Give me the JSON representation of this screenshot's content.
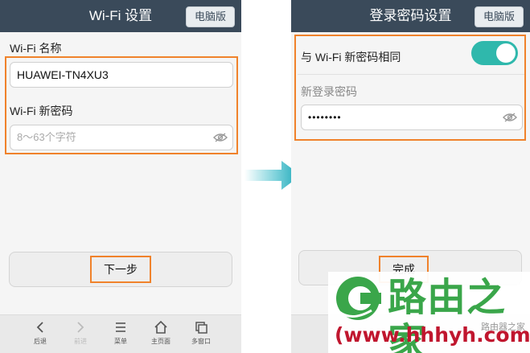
{
  "left": {
    "title": "Wi-Fi 设置",
    "pc_button": "电脑版",
    "ssid_label": "Wi-Fi 名称",
    "ssid_value": "HUAWEI-TN4XU3",
    "password_label": "Wi-Fi 新密码",
    "password_placeholder": "8～63个字符",
    "next_button": "下一步",
    "nav": {
      "back": "后退",
      "forward": "前进",
      "menu": "菜单",
      "home": "主页面",
      "windows": "多窗口"
    }
  },
  "right": {
    "title": "登录密码设置",
    "pc_button": "电脑版",
    "same_as_wifi_label": "与 Wi-Fi 新密码相同",
    "same_as_wifi_enabled": true,
    "login_password_label": "新登录密码",
    "login_password_value": "••••••••",
    "done_button": "完成"
  },
  "watermark": {
    "brand": "路由之家",
    "url": "(www.hhhyh.com)",
    "sub": "路由器之家"
  },
  "colors": {
    "header": "#3a4a5a",
    "highlight": "#f0822b",
    "toggle_on": "#2fb8ac",
    "arrow": "#1aa7b8",
    "brand_green": "#3aa64a",
    "brand_red": "#c0162e"
  }
}
